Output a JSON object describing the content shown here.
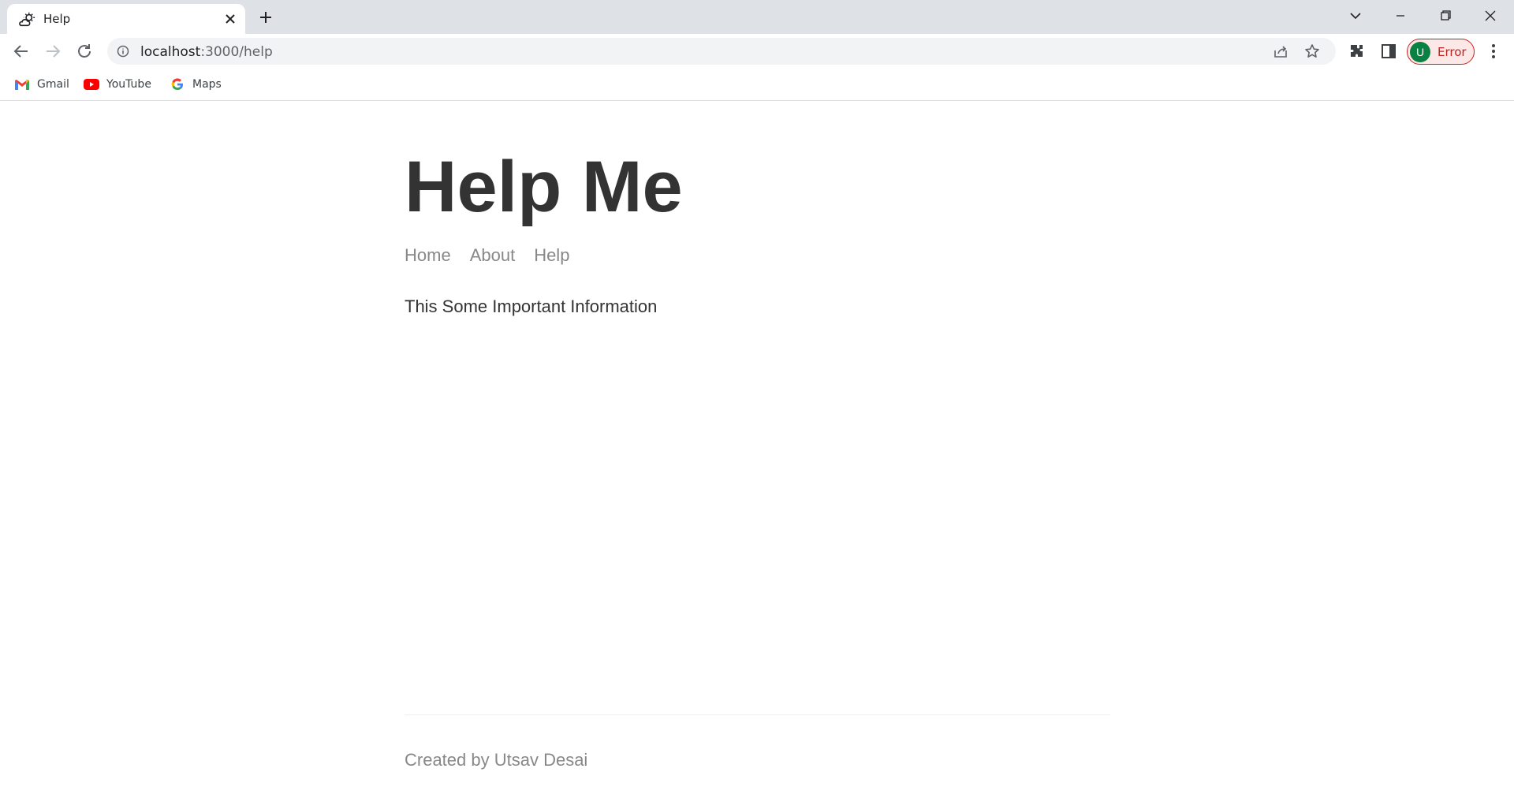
{
  "browser": {
    "tab": {
      "title": "Help"
    },
    "address": {
      "host": "localhost",
      "path": ":3000/help"
    },
    "profile": {
      "initial": "U",
      "status": "Error"
    },
    "bookmarks": [
      {
        "label": "Gmail",
        "icon": "gmail-icon"
      },
      {
        "label": "YouTube",
        "icon": "youtube-icon"
      },
      {
        "label": "Maps",
        "icon": "google-icon"
      }
    ]
  },
  "page": {
    "title": "Help Me",
    "nav": [
      "Home",
      "About",
      "Help"
    ],
    "message": "This Some Important Information",
    "footer": "Created by Utsav Desai"
  }
}
